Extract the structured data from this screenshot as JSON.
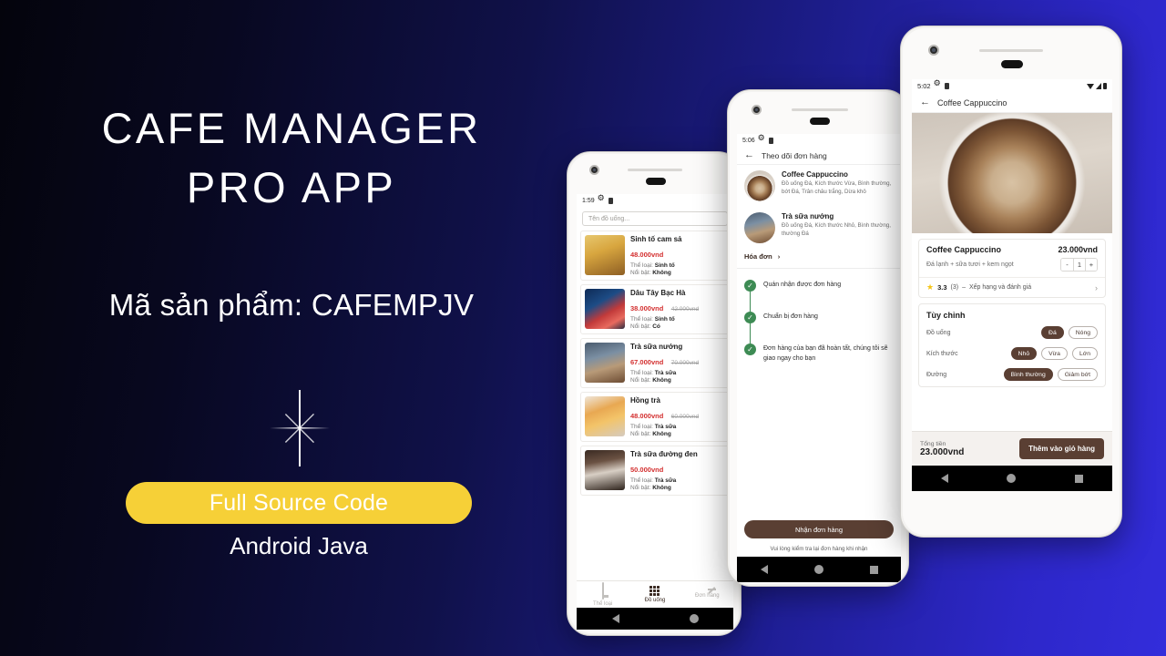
{
  "promo": {
    "title_line1": "CAFE MANAGER",
    "title_line2": "PRO APP",
    "product_code_label": "Mã sản phẩm: CAFEMPJV",
    "cta_label": "Full Source Code",
    "cta_sub": "Android Java",
    "accent_color": "#f6d037",
    "bg_dark": "#04040c",
    "bg_blue": "#332ddb"
  },
  "phone_left": {
    "status": {
      "time": "1:59"
    },
    "search": {
      "placeholder": "Tên đồ uống..."
    },
    "labels": {
      "type": "Thể loại:",
      "featured": "Nổi bật:"
    },
    "products": [
      {
        "name": "Sinh tố cam sả",
        "price": "48.000vnd",
        "old_price": "",
        "type": "Sinh tố",
        "featured": "Không",
        "img": "img-smoothie"
      },
      {
        "name": "Dâu Tây Bạc Hà",
        "price": "38.000vnd",
        "old_price": "42.000vnd",
        "type": "Sinh tố",
        "featured": "Có",
        "img": "img-straw"
      },
      {
        "name": "Trà sữa nướng",
        "price": "67.000vnd",
        "old_price": "70.000vnd",
        "type": "Trà sữa",
        "featured": "Không",
        "img": "img-milktea"
      },
      {
        "name": "Hồng trà",
        "price": "48.000vnd",
        "old_price": "60.000vnd",
        "type": "Trà sữa",
        "featured": "Không",
        "img": "img-hongtra"
      },
      {
        "name": "Trà sữa đường đen",
        "price": "50.000vnd",
        "old_price": "",
        "type": "Trà sữa",
        "featured": "Không",
        "img": "img-duongden"
      }
    ],
    "bottom_nav": [
      {
        "label": "Thể loại",
        "icon": "category-icon",
        "active": false
      },
      {
        "label": "Đồ uống",
        "icon": "grid-icon",
        "active": true
      },
      {
        "label": "Đơn hàng",
        "icon": "pencil-icon",
        "active": false
      }
    ]
  },
  "phone_middle": {
    "status": {
      "time": "5:06"
    },
    "appbar_title": "Theo dõi đơn hàng",
    "order_items": [
      {
        "name": "Coffee Cappuccino",
        "desc": "Đồ uống Đá, Kích thước Vừa, Bình thường, bớt Đá, Trân châu trắng, Dừa khô",
        "img": "img-cappuccino"
      },
      {
        "name": "Trà sữa nướng",
        "desc": "Đồ uống Đá, Kích thước Nhỏ, Bình thường, thường Đá",
        "img": "img-milktea"
      }
    ],
    "invoice_label": "Hóa đơn",
    "timeline": [
      {
        "text": "Quán nhận được đơn hàng",
        "done": true
      },
      {
        "text": "Chuẩn bị đơn hàng",
        "done": true
      },
      {
        "text": "Đơn hàng của bạn đã hoàn tất, chúng tôi sẽ giao ngay cho bạn",
        "done": true
      }
    ],
    "receive_button": "Nhận đơn hàng",
    "receive_note": "Vui lòng kiểm tra lại đơn hàng khi nhận"
  },
  "phone_right": {
    "status": {
      "time": "5:02"
    },
    "appbar_title": "Coffee Cappuccino",
    "product": {
      "name": "Coffee Cappuccino",
      "price": "23.000vnd",
      "description": "Đá lạnh + sữa tươi + kem ngọt",
      "qty_minus": "-",
      "qty": "1",
      "qty_plus": "+"
    },
    "rating": {
      "score": "3.3",
      "count": "(3)",
      "dash": "–",
      "label": "Xếp hạng và đánh giá"
    },
    "customize": {
      "title": "Tùy chỉnh",
      "rows": [
        {
          "label": "Đồ uống",
          "options": [
            {
              "label": "Đá",
              "selected": true
            },
            {
              "label": "Nóng",
              "selected": false
            }
          ]
        },
        {
          "label": "Kích thước",
          "options": [
            {
              "label": "Nhỏ",
              "selected": true
            },
            {
              "label": "Vừa",
              "selected": false
            },
            {
              "label": "Lớn",
              "selected": false
            }
          ]
        },
        {
          "label": "Đường",
          "options": [
            {
              "label": "Bình thường",
              "selected": true
            },
            {
              "label": "Giảm bớt",
              "selected": false
            }
          ]
        }
      ]
    },
    "total": {
      "label": "Tổng tiền",
      "value": "23.000vnd",
      "button": "Thêm vào giỏ hàng"
    }
  }
}
